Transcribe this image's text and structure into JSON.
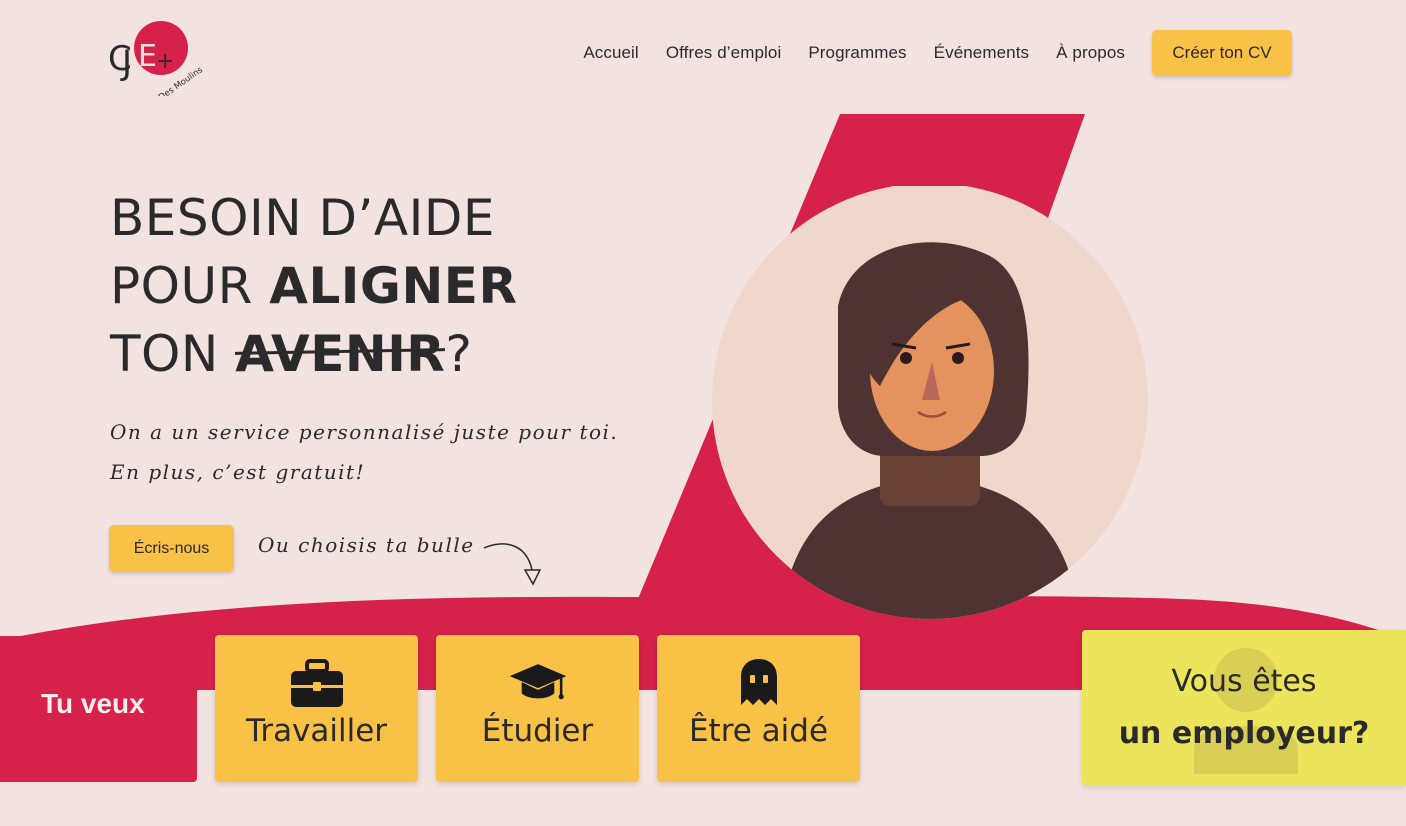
{
  "logo": {
    "mark": "CJE+",
    "subtitle": "Des Moulins"
  },
  "nav": {
    "links": [
      "Accueil",
      "Offres d’emploi",
      "Programmes",
      "Événements",
      "À propos"
    ],
    "cta": "Créer ton CV"
  },
  "hero": {
    "line1": "BESOIN D’AIDE",
    "line2_a": "POUR ",
    "line2_b": "ALIGNER",
    "line3_a": "TON ",
    "line3_b": "AVENIR",
    "line3_c": "?",
    "sub_line1": "On a un service personnalisé juste pour toi.",
    "sub_line2": "En plus, c’est gratuit!",
    "button": "Écris-nous",
    "choose_text": "Ou choisis ta bulle"
  },
  "choices": {
    "intro": "Tu veux",
    "items": [
      {
        "label": "Travailler",
        "icon": "briefcase-icon"
      },
      {
        "label": "Étudier",
        "icon": "graduation-cap-icon"
      },
      {
        "label": "Être aidé",
        "icon": "ghost-icon"
      }
    ]
  },
  "employer": {
    "line1": "Vous êtes",
    "line2": "un employeur?"
  },
  "colors": {
    "background": "#f2e3e1",
    "brand_red": "#d6214b",
    "yellow": "#f9c146",
    "employer_yellow": "#ece55b",
    "text": "#2b2a2a"
  }
}
